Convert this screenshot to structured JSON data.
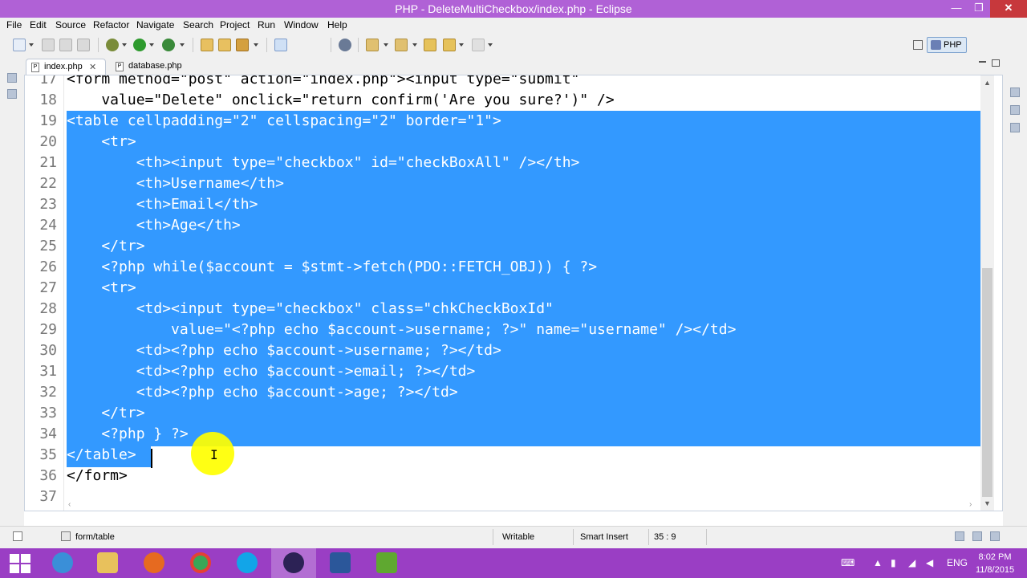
{
  "window": {
    "title": "PHP - DeleteMultiCheckbox/index.php - Eclipse",
    "minimize_glyph": "—",
    "maximize_glyph": "❐",
    "close_glyph": "✕"
  },
  "menu": [
    "File",
    "Edit",
    "Source",
    "Refactor",
    "Navigate",
    "Search",
    "Project",
    "Run",
    "Window",
    "Help"
  ],
  "perspective": {
    "label": "PHP"
  },
  "tabs": [
    {
      "label": "index.php",
      "active": true,
      "close": "✕",
      "icon": "P"
    },
    {
      "label": "database.php",
      "active": false,
      "icon": "P"
    }
  ],
  "editor": {
    "lines": [
      {
        "num": "17",
        "text": "<form method=\"post\" action=\"index.php\"><input type=\"submit\"",
        "selected": false
      },
      {
        "num": "18",
        "text": "    value=\"Delete\" onclick=\"return confirm('Are you sure?')\" />",
        "selected": false
      },
      {
        "num": "19",
        "text": "<table cellpadding=\"2\" cellspacing=\"2\" border=\"1\">",
        "selected": true
      },
      {
        "num": "20",
        "text": "    <tr>",
        "selected": true
      },
      {
        "num": "21",
        "text": "        <th><input type=\"checkbox\" id=\"checkBoxAll\" /></th>",
        "selected": true
      },
      {
        "num": "22",
        "text": "        <th>Username</th>",
        "selected": true
      },
      {
        "num": "23",
        "text": "        <th>Email</th>",
        "selected": true
      },
      {
        "num": "24",
        "text": "        <th>Age</th>",
        "selected": true
      },
      {
        "num": "25",
        "text": "    </tr>",
        "selected": true
      },
      {
        "num": "26",
        "text": "    <?php while($account = $stmt->fetch(PDO::FETCH_OBJ)) { ?>",
        "selected": true
      },
      {
        "num": "27",
        "text": "    <tr>",
        "selected": true
      },
      {
        "num": "28",
        "text": "        <td><input type=\"checkbox\" class=\"chkCheckBoxId\"",
        "selected": true
      },
      {
        "num": "29",
        "text": "            value=\"<?php echo $account->username; ?>\" name=\"username\" /></td>",
        "selected": true
      },
      {
        "num": "30",
        "text": "        <td><?php echo $account->username; ?></td>",
        "selected": true
      },
      {
        "num": "31",
        "text": "        <td><?php echo $account->email; ?></td>",
        "selected": true
      },
      {
        "num": "32",
        "text": "        <td><?php echo $account->age; ?></td>",
        "selected": true
      },
      {
        "num": "33",
        "text": "    </tr>",
        "selected": true
      },
      {
        "num": "34",
        "text": "    <?php } ?>",
        "selected": true
      },
      {
        "num": "35",
        "text": "</table>",
        "selected": true
      },
      {
        "num": "36",
        "text": "</form>",
        "selected": false
      },
      {
        "num": "37",
        "text": "",
        "selected": false
      }
    ]
  },
  "status": {
    "breadcrumb": "form/table",
    "writable": "Writable",
    "insert_mode": "Smart Insert",
    "position": "35 : 9"
  },
  "taskbar": {
    "language": "ENG",
    "time": "8:02 PM",
    "date": "11/8/2015"
  },
  "colors": {
    "title_bar": "#b061d6",
    "taskbar": "#9a3ec4",
    "selection": "#3399ff",
    "close_button": "#c7383c",
    "cursor_highlight": "#ffff00"
  }
}
